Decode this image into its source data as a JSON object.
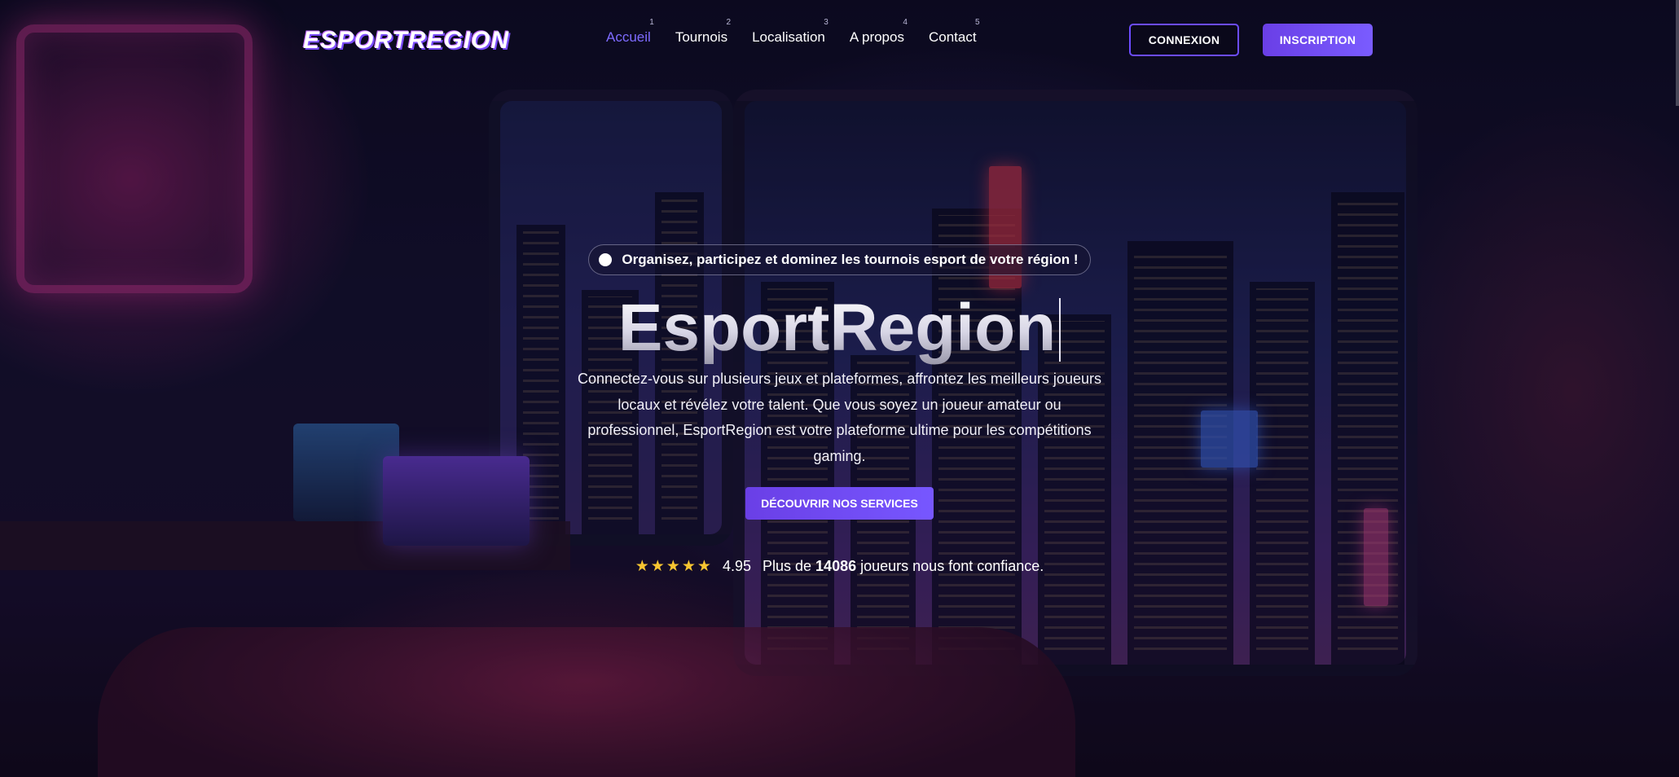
{
  "header": {
    "logo_text": "ESPORTREGION",
    "nav": [
      {
        "num": "1",
        "label": "Accueil",
        "active": true
      },
      {
        "num": "2",
        "label": "Tournois",
        "active": false
      },
      {
        "num": "3",
        "label": "Localisation",
        "active": false
      },
      {
        "num": "4",
        "label": "A propos",
        "active": false
      },
      {
        "num": "5",
        "label": "Contact",
        "active": false
      }
    ],
    "login_label": "CONNEXION",
    "signup_label": "INSCRIPTION"
  },
  "hero": {
    "badge_text": "Organisez, participez et dominez les tournois esport de votre région !",
    "title": "EsportRegion",
    "description": "Connectez-vous sur plusieurs jeux et plateformes, affrontez les meilleurs joueurs locaux et révélez votre talent. Que vous soyez un joueur amateur ou professionnel, EsportRegion est votre plateforme ultime pour les compétitions gaming.",
    "cta_label": "DÉCOUVRIR NOS SERVICES",
    "rating": {
      "stars": 5,
      "value": "4.95",
      "text_prefix": "Plus de",
      "count": "14086",
      "text_suffix": "joueurs nous font confiance."
    }
  },
  "colors": {
    "accent": "#6a3fe6",
    "active_nav": "#7e6bff",
    "star": "#f7c531",
    "background": "#0b0a1c"
  },
  "icons": {
    "badge_dot": "circle-dot-icon",
    "star": "star-icon"
  }
}
